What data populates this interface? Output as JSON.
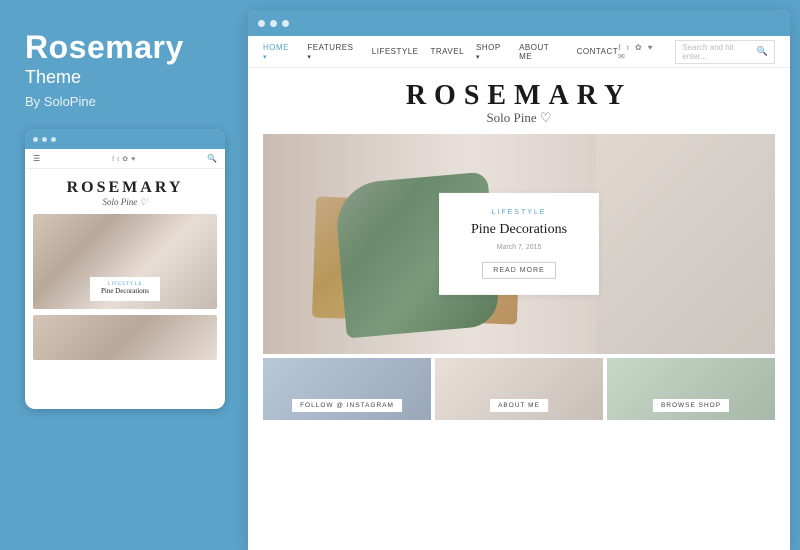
{
  "left": {
    "title": "Rosemary",
    "subtitle": "Theme",
    "by": "By SoloPine"
  },
  "mobile": {
    "logo": "ROSEMARY",
    "logo_sub": "Solo Pine ♡",
    "hero_category": "LIFESTYLE",
    "hero_title": "Pine Decorations"
  },
  "desktop": {
    "logo": "ROSEMARY",
    "logo_sub": "Solo Pine ♡",
    "nav": {
      "items": [
        "HOME",
        "FEATURES",
        "LIFESTYLE",
        "TRAVEL",
        "SHOP",
        "ABOUT ME",
        "CONTACT"
      ],
      "search_placeholder": "Search and hit enter..."
    },
    "hero": {
      "category": "LIFESTYLE",
      "title": "Pine Decorations",
      "date": "March 7, 2015",
      "button": "READ MORE"
    },
    "strip": {
      "items": [
        "FOLLOW @ INSTAGRAM",
        "ABOUT ME",
        "BROWSE SHOP"
      ]
    },
    "dots": [
      "•",
      "•",
      "•"
    ]
  },
  "colors": {
    "accent": "#5ba3c9",
    "text_dark": "#1a1a1a",
    "text_muted": "#999"
  }
}
